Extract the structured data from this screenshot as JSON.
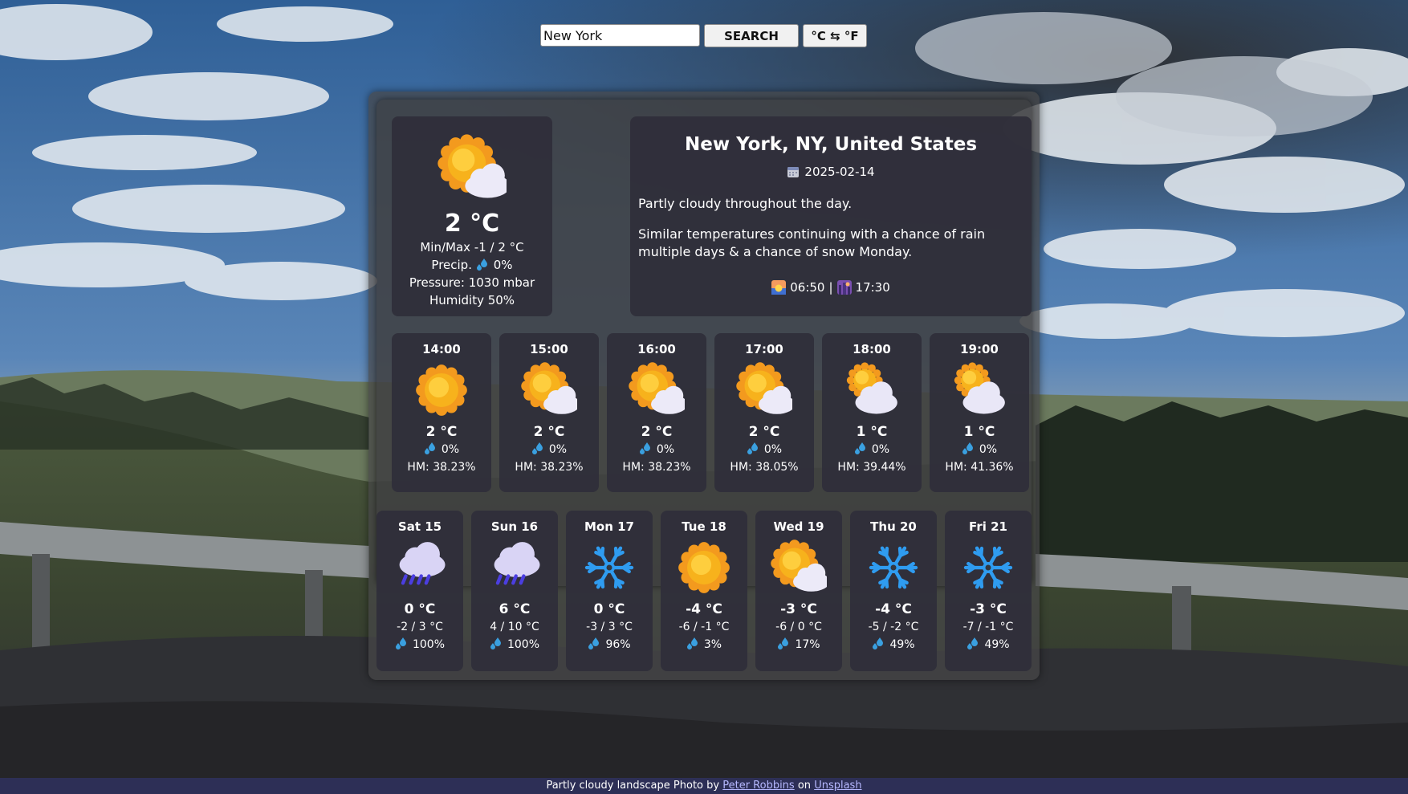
{
  "search": {
    "value": "New York",
    "button_label": "SEARCH",
    "toggle_label": "°C ⇆ °F"
  },
  "current": {
    "icon": "partly-cloudy-icon",
    "temp": "2 °C",
    "minmax": "Min/Max -1 / 2 °C",
    "precip_label": "Precip.",
    "precip": "0%",
    "pressure": "Pressure: 1030 mbar",
    "humidity": "Humidity 50%"
  },
  "info": {
    "location": "New York, NY, United States",
    "date": "2025-02-14",
    "desc1": "Partly cloudy throughout the day.",
    "desc2": "Similar temperatures continuing with a chance of rain multiple days & a chance of snow Monday.",
    "sunrise": "06:50",
    "separator": "|",
    "sunset": "17:30"
  },
  "hourly": [
    {
      "time": "14:00",
      "icon": "sun-icon",
      "temp": "2 °C",
      "precip": "0%",
      "hm": "HM: 38.23%"
    },
    {
      "time": "15:00",
      "icon": "partly-cloudy-icon",
      "temp": "2 °C",
      "precip": "0%",
      "hm": "HM: 38.23%"
    },
    {
      "time": "16:00",
      "icon": "partly-cloudy-icon",
      "temp": "2 °C",
      "precip": "0%",
      "hm": "HM: 38.23%"
    },
    {
      "time": "17:00",
      "icon": "partly-cloudy-icon",
      "temp": "2 °C",
      "precip": "0%",
      "hm": "HM: 38.05%"
    },
    {
      "time": "18:00",
      "icon": "mostly-cloudy-icon",
      "temp": "1 °C",
      "precip": "0%",
      "hm": "HM: 39.44%"
    },
    {
      "time": "19:00",
      "icon": "mostly-cloudy-icon",
      "temp": "1 °C",
      "precip": "0%",
      "hm": "HM: 41.36%"
    }
  ],
  "daily": [
    {
      "day": "Sat 15",
      "icon": "rain-icon",
      "temp": "0 °C",
      "minmax": "-2 / 3 °C",
      "precip": "100%"
    },
    {
      "day": "Sun 16",
      "icon": "rain-icon",
      "temp": "6 °C",
      "minmax": "4 / 10 °C",
      "precip": "100%"
    },
    {
      "day": "Mon 17",
      "icon": "snowflake-icon",
      "temp": "0 °C",
      "minmax": "-3 / 3 °C",
      "precip": "96%"
    },
    {
      "day": "Tue 18",
      "icon": "sun-icon",
      "temp": "-4 °C",
      "minmax": "-6 / -1 °C",
      "precip": "3%"
    },
    {
      "day": "Wed 19",
      "icon": "partly-cloudy-icon",
      "temp": "-3 °C",
      "minmax": "-6 / 0 °C",
      "precip": "17%"
    },
    {
      "day": "Thu 20",
      "icon": "snowflake-icon",
      "temp": "-4 °C",
      "minmax": "-5 / -2 °C",
      "precip": "49%"
    },
    {
      "day": "Fri 21",
      "icon": "snowflake-icon",
      "temp": "-3 °C",
      "minmax": "-7 / -1 °C",
      "precip": "49%"
    }
  ],
  "footer": {
    "text_before": "Partly cloudy landscape Photo by",
    "author": "Peter Robbins",
    "text_mid": "on",
    "site": "Unsplash"
  },
  "colors": {
    "card_bg": "#302f3a",
    "panel_bg": "#464648",
    "footer_bg": "#2d2f56",
    "link": "#b6b8ff",
    "sun": "#f7b21c",
    "snow": "#2f9cf0",
    "drop": "#3aa0e0"
  }
}
